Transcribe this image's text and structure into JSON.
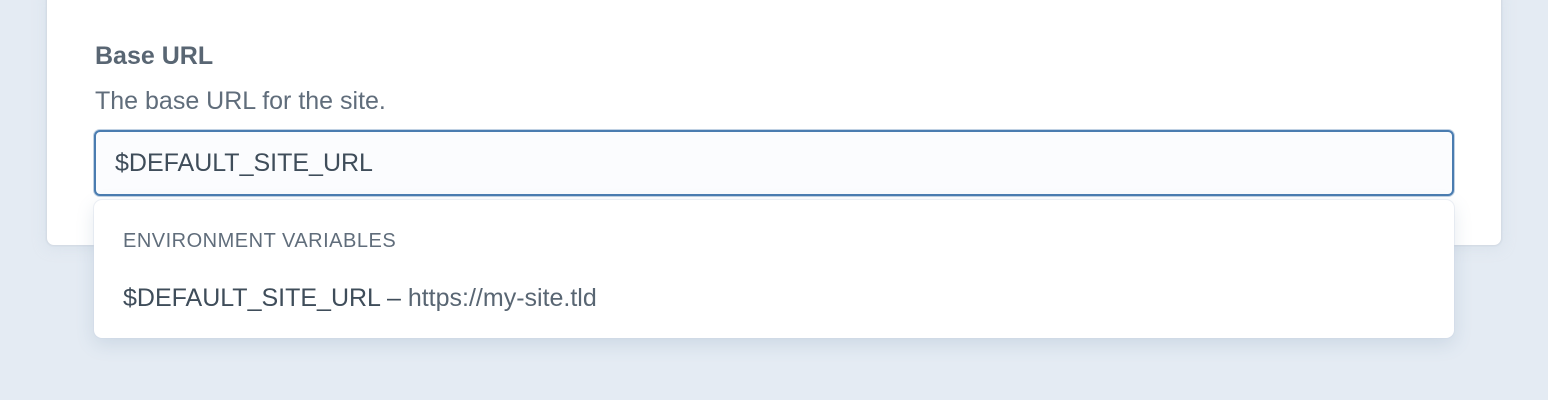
{
  "field": {
    "label": "Base URL",
    "instructions": "The base URL for the site.",
    "value": "$DEFAULT_SITE_URL"
  },
  "suggestions": {
    "heading": "ENVIRONMENT VARIABLES",
    "items": [
      {
        "name": "$DEFAULT_SITE_URL",
        "separator": " – ",
        "value": "https://my-site.tld"
      }
    ]
  },
  "colors": {
    "page_background": "#e4ebf3",
    "focus_ring": "#4a7cb0",
    "text": "#3f4d5a",
    "muted_text": "#606d7b"
  }
}
